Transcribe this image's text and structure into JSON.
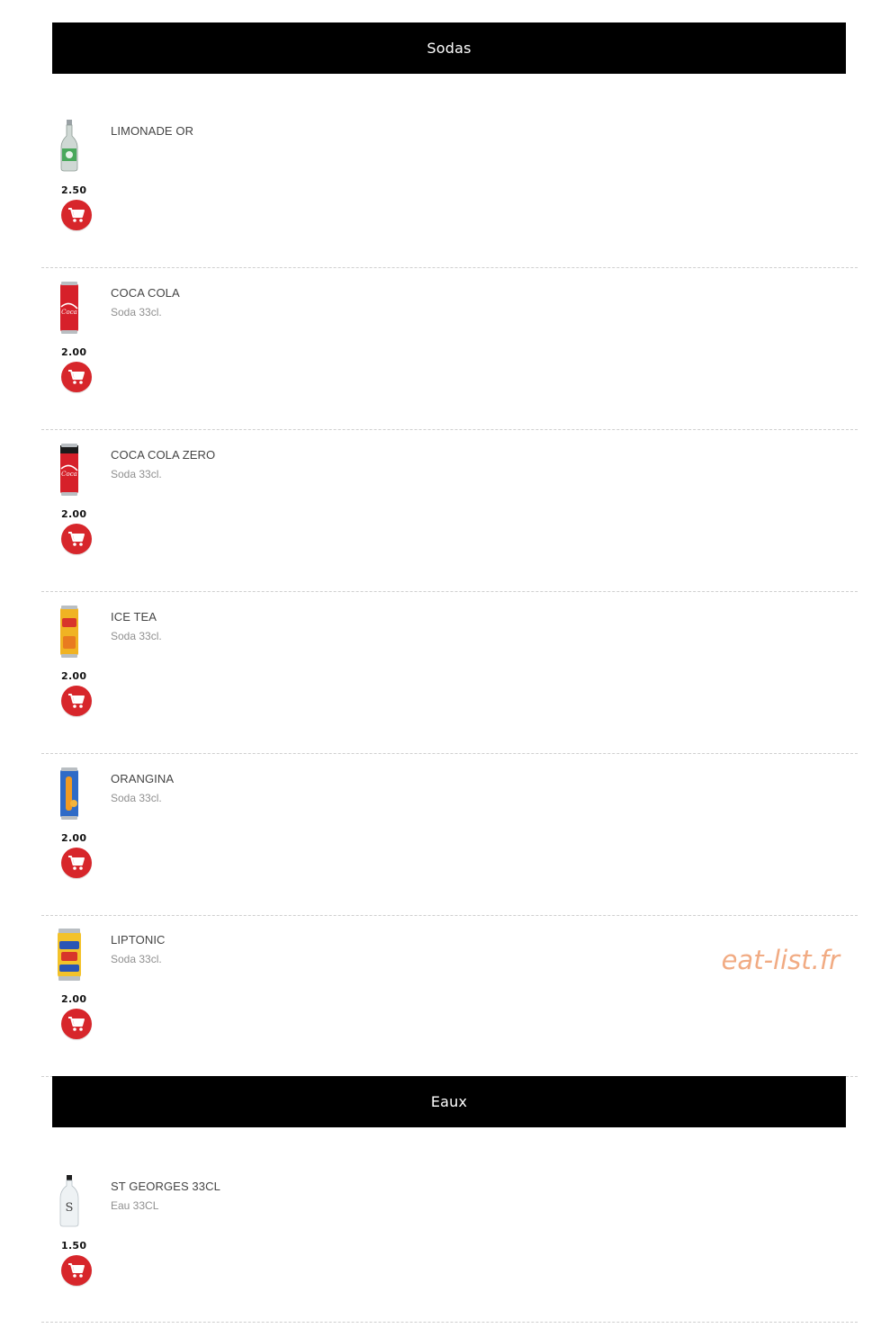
{
  "sections": [
    {
      "title": "Sodas"
    },
    {
      "title": "Eaux"
    }
  ],
  "products": [
    {
      "name": "LIMONADE OR",
      "description": "",
      "price": "2.50",
      "icon": "glass-bottle-icon",
      "color": "#5bb36a"
    },
    {
      "name": "COCA COLA",
      "description": "Soda 33cl.",
      "price": "2.00",
      "icon": "soda-can-icon",
      "color": "#d6202a"
    },
    {
      "name": "COCA COLA ZERO",
      "description": "Soda 33cl.",
      "price": "2.00",
      "icon": "soda-can-icon",
      "color": "#d6202a"
    },
    {
      "name": "ICE TEA",
      "description": "Soda 33cl.",
      "price": "2.00",
      "icon": "soda-can-icon",
      "color": "#f0b323"
    },
    {
      "name": "ORANGINA",
      "description": "Soda 33cl.",
      "price": "2.00",
      "icon": "soda-can-icon",
      "color": "#2f6bc7"
    },
    {
      "name": "LIPTONIC",
      "description": "Soda 33cl.",
      "price": "2.00",
      "icon": "soda-can-icon",
      "color": "#f3c22a"
    },
    {
      "name": "ST GEORGES 33CL",
      "description": "Eau 33CL",
      "price": "1.50",
      "icon": "water-bottle-icon",
      "color": "#dfe6ea"
    }
  ],
  "watermark": "eat-list.fr",
  "colors": {
    "header_bg": "#000000",
    "cart_button": "#d7262b",
    "watermark": "#f0a276"
  }
}
